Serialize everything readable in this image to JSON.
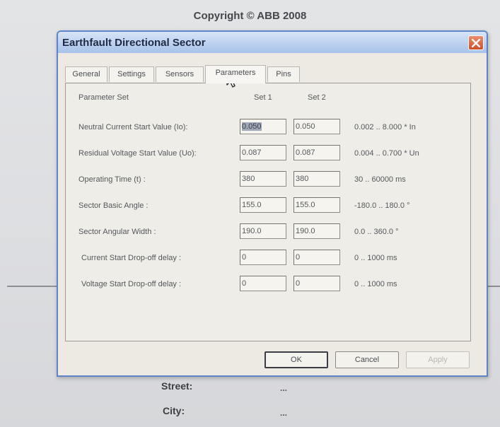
{
  "background": {
    "copyright": "Copyright © ABB 2008",
    "fields": [
      {
        "label": "Street:",
        "value": "..."
      },
      {
        "label": "City:",
        "value": "..."
      }
    ]
  },
  "dialog": {
    "title": "Earthfault Directional Sector",
    "tabs": [
      {
        "label": "General",
        "active": false
      },
      {
        "label": "Settings",
        "active": false
      },
      {
        "label": "Sensors",
        "active": false
      },
      {
        "label": "Parameters",
        "active": true
      },
      {
        "label": "Pins",
        "active": false
      }
    ],
    "headers": {
      "parameter_set": "Parameter Set",
      "set1": "Set 1",
      "set2": "Set 2"
    },
    "parameters": [
      {
        "label": "Neutral Current Start Value (Io):",
        "set1": "0.050",
        "set2": "0.050",
        "range": "0.002 .. 8.000 * In"
      },
      {
        "label": "Residual Voltage Start Value (Uo):",
        "set1": "0.087",
        "set2": "0.087",
        "range": "0.004 .. 0.700 * Un"
      },
      {
        "label": "Operating Time (t) :",
        "set1": "380",
        "set2": "380",
        "range": "30 .. 60000 ms"
      },
      {
        "label": "Sector Basic Angle :",
        "set1": "155.0",
        "set2": "155.0",
        "range": "-180.0 .. 180.0 °"
      },
      {
        "label": "Sector Angular Width :",
        "set1": "190.0",
        "set2": "190.0",
        "range": "0.0 .. 360.0 °"
      },
      {
        "label": "Current Start Drop-off delay :",
        "set1": "0",
        "set2": "0",
        "range": "0 .. 1000 ms"
      },
      {
        "label": "Voltage Start Drop-off delay :",
        "set1": "0",
        "set2": "0",
        "range": "0 .. 1000 ms"
      }
    ],
    "buttons": {
      "ok": "OK",
      "cancel": "Cancel",
      "apply": "Apply"
    }
  },
  "icons": {
    "close": "close-icon",
    "cursor": "mouse-pointer-icon"
  },
  "colors": {
    "titlebar": "#bdd1ef",
    "close_button": "#d04e2a",
    "dialog_body": "#eceae2"
  }
}
